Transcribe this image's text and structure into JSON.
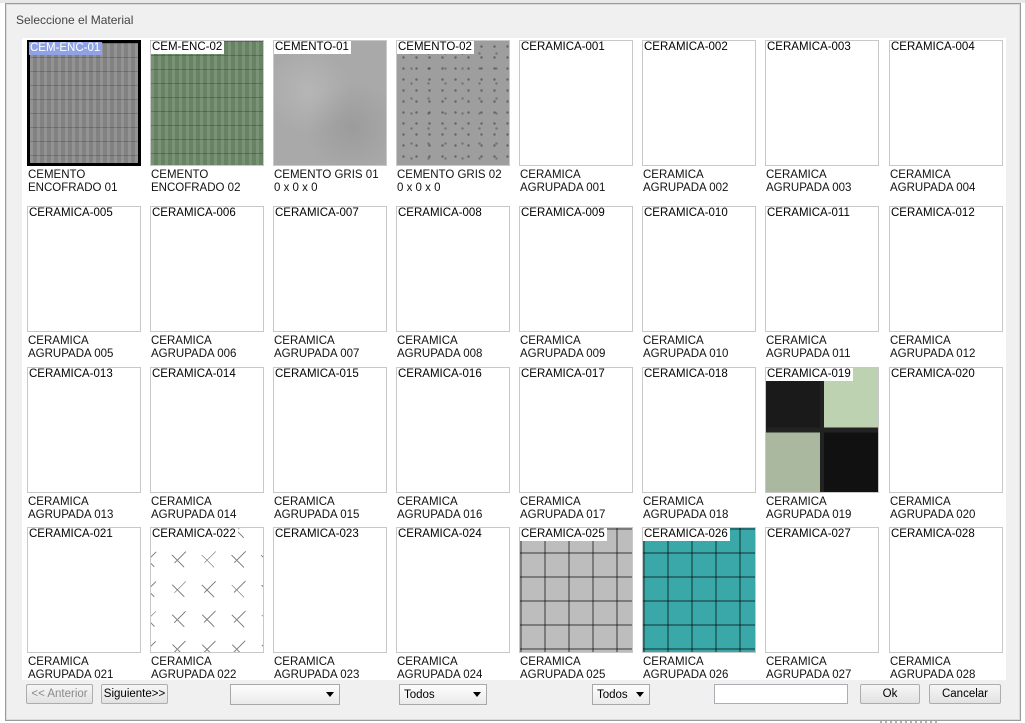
{
  "dialog": {
    "title": "Seleccione el Material"
  },
  "materials": [
    {
      "code": "CEM-ENC-01",
      "desc": "CEMENTO\nENCOFRADO 01",
      "tex": "woodgray",
      "selected": true
    },
    {
      "code": "CEM-ENC-02",
      "desc": "CEMENTO\nENCOFRADO 02",
      "tex": "woodgreen"
    },
    {
      "code": "CEMENTO-01",
      "desc": "CEMENTO GRIS 01\n0 x 0 x 0",
      "tex": "cement1"
    },
    {
      "code": "CEMENTO-02",
      "desc": "CEMENTO GRIS 02\n0 x 0 x 0",
      "tex": "cement2"
    },
    {
      "code": "CERAMICA-001",
      "desc": "CERAMICA\nAGRUPADA 001",
      "tex": "speck",
      "b": "#2e2f30",
      "s1": "#555",
      "s2": "#1a1a1a",
      "g": "#1e1e1e"
    },
    {
      "code": "CERAMICA-002",
      "desc": "CERAMICA\nAGRUPADA 002",
      "tex": "speck",
      "b": "#8a6e58",
      "s1": "#5a4536",
      "s2": "#b09078",
      "g": "#4a4a4a"
    },
    {
      "code": "CERAMICA-003",
      "desc": "CERAMICA\nAGRUPADA 003",
      "tex": "speck",
      "b": "#b97f68",
      "s1": "#6a3e30",
      "s2": "#d8a590",
      "g": "#555"
    },
    {
      "code": "CERAMICA-004",
      "desc": "CERAMICA\nAGRUPADA 004",
      "tex": "speck",
      "b": "#a88478",
      "s1": "#5a3f38",
      "s2": "#caa69a",
      "g": "#555"
    },
    {
      "code": "CERAMICA-005",
      "desc": "CERAMICA\nAGRUPADA 005",
      "tex": "speck",
      "b": "#c0a090",
      "s1": "#8a6a58",
      "s2": "#e0c8b8",
      "g": "#5a5a5a"
    },
    {
      "code": "CERAMICA-006",
      "desc": "CERAMICA\nAGRUPADA 006",
      "tex": "speck",
      "b": "#bba79a",
      "s1": "#5e4c42",
      "s2": "#dccabc",
      "g": "#555"
    },
    {
      "code": "CERAMICA-007",
      "desc": "CERAMICA\nAGRUPADA 007",
      "tex": "speck",
      "b": "#e6d8d0",
      "s1": "#a88070",
      "s2": "#f5ece6",
      "g": "#555"
    },
    {
      "code": "CERAMICA-008",
      "desc": "CERAMICA\nAGRUPADA 008",
      "tex": "speck",
      "b": "#ecdcd6",
      "s1": "#cfb0a6",
      "s2": "#f7eeea",
      "g": "#555"
    },
    {
      "code": "CERAMICA-009",
      "desc": "CERAMICA\nAGRUPADA 009",
      "tex": "speck",
      "b": "#f0dcd4",
      "s1": "#d8b8aa",
      "s2": "#fbf0ec",
      "g": "#555"
    },
    {
      "code": "CERAMICA-010",
      "desc": "CERAMICA\nAGRUPADA 010",
      "tex": "speck",
      "b": "#f3e8e2",
      "s1": "#e0ccc2",
      "s2": "#fbf6f2",
      "g": "#666"
    },
    {
      "code": "CERAMICA-011",
      "desc": "CERAMICA\nAGRUPADA 011",
      "tex": "speck",
      "b": "#c6f7c6",
      "s1": "#c6f7c6",
      "s2": "#c6f7c6",
      "g": "#e8ffe8"
    },
    {
      "code": "CERAMICA-012",
      "desc": "CERAMICA\nAGRUPADA 012",
      "tex": "speck",
      "b": "#8a4a3a",
      "s1": "#5a2a20",
      "s2": "#a86a58",
      "g": "#6a3a30"
    },
    {
      "code": "CERAMICA-013",
      "desc": "CERAMICA\nAGRUPADA 013",
      "tex": "speck",
      "b": "#4a6a9a",
      "s1": "#33507a",
      "s2": "#6a88b8",
      "g": "#b7a9c9"
    },
    {
      "code": "CERAMICA-014",
      "desc": "CERAMICA\nAGRUPADA 014",
      "tex": "speck",
      "b": "#3e4248",
      "s1": "#222",
      "s2": "#6a6e74",
      "g": "#777"
    },
    {
      "code": "CERAMICA-015",
      "desc": "CERAMICA\nAGRUPADA 015",
      "tex": "speck",
      "b": "#b09070",
      "s1": "#8c6e52",
      "s2": "#c8aa88",
      "g": "#6a5a3a"
    },
    {
      "code": "CERAMICA-016",
      "desc": "CERAMICA\nAGRUPADA 016",
      "tex": "speck",
      "b": "#c8a47a",
      "s1": "#a88460",
      "s2": "#dcbc94",
      "g": "#c0a070"
    },
    {
      "code": "CERAMICA-017",
      "desc": "CERAMICA\nAGRUPADA 017",
      "tex": "speck",
      "b": "#a85848",
      "s1": "#7a3a2e",
      "s2": "#c8786a",
      "g": "#bbb"
    },
    {
      "code": "CERAMICA-018",
      "desc": "CERAMICA\nAGRUPADA 018",
      "tex": "speck",
      "b": "#f2e4dc",
      "s1": "#c89080",
      "s2": "#e8c8a0",
      "g": "#888"
    },
    {
      "code": "CERAMICA-019",
      "desc": "CERAMICA\nAGRUPADA 019",
      "tex": "glass"
    },
    {
      "code": "CERAMICA-020",
      "desc": "CERAMICA\nAGRUPADA 020",
      "tex": "speck",
      "b": "#e6dcd2",
      "s1": "#b89070",
      "s2": "#f6f0ea",
      "g": "#ddd"
    },
    {
      "code": "CERAMICA-021",
      "desc": "CERAMICA\nAGRUPADA 021",
      "tex": "speck",
      "b": "#8a8a80",
      "s1": "#5a5a52",
      "s2": "#a8a89e",
      "g": "#222"
    },
    {
      "code": "CERAMICA-022",
      "desc": "CERAMICA\nAGRUPADA 022",
      "tex": "octa"
    },
    {
      "code": "CERAMICA-023",
      "desc": "CERAMICA\nAGRUPADA 023",
      "tex": "speck",
      "b": "#f4f4f4",
      "s1": "#dcdcdc",
      "s2": "#f4f4f4",
      "g": "#111"
    },
    {
      "code": "CERAMICA-024",
      "desc": "CERAMICA\nAGRUPADA 024",
      "tex": "speck",
      "b": "#cfcfcf",
      "s1": "#555",
      "s2": "#eee",
      "g": "#444"
    },
    {
      "code": "CERAMICA-025",
      "desc": "CERAMICA\nAGRUPADA 025",
      "tex": "smallgrid",
      "b": "#bdbdbd"
    },
    {
      "code": "CERAMICA-026",
      "desc": "CERAMICA\nAGRUPADA 026",
      "tex": "smallgrid",
      "b": "#3aa8a8"
    },
    {
      "code": "CERAMICA-027",
      "desc": "CERAMICA\nAGRUPADA 027",
      "tex": "speck",
      "b": "#4a3a2a",
      "s1": "#2a1e14",
      "s2": "#8a7050",
      "g": "#1a1a1a"
    },
    {
      "code": "CERAMICA-028",
      "desc": "CERAMICA\nAGRUPADA 028",
      "tex": "speck",
      "b": "#9a7a18",
      "s1": "#6a5210",
      "s2": "#b8962a",
      "g": "#3a2e08"
    }
  ],
  "footer": {
    "prev_label": "<< Anterior",
    "next_label": "Siguiente>>",
    "filter1_value": "",
    "filter2_value": "Todos",
    "filter3_value": "Todos",
    "search_value": "",
    "ok_label": "Ok",
    "cancel_label": "Cancelar"
  }
}
